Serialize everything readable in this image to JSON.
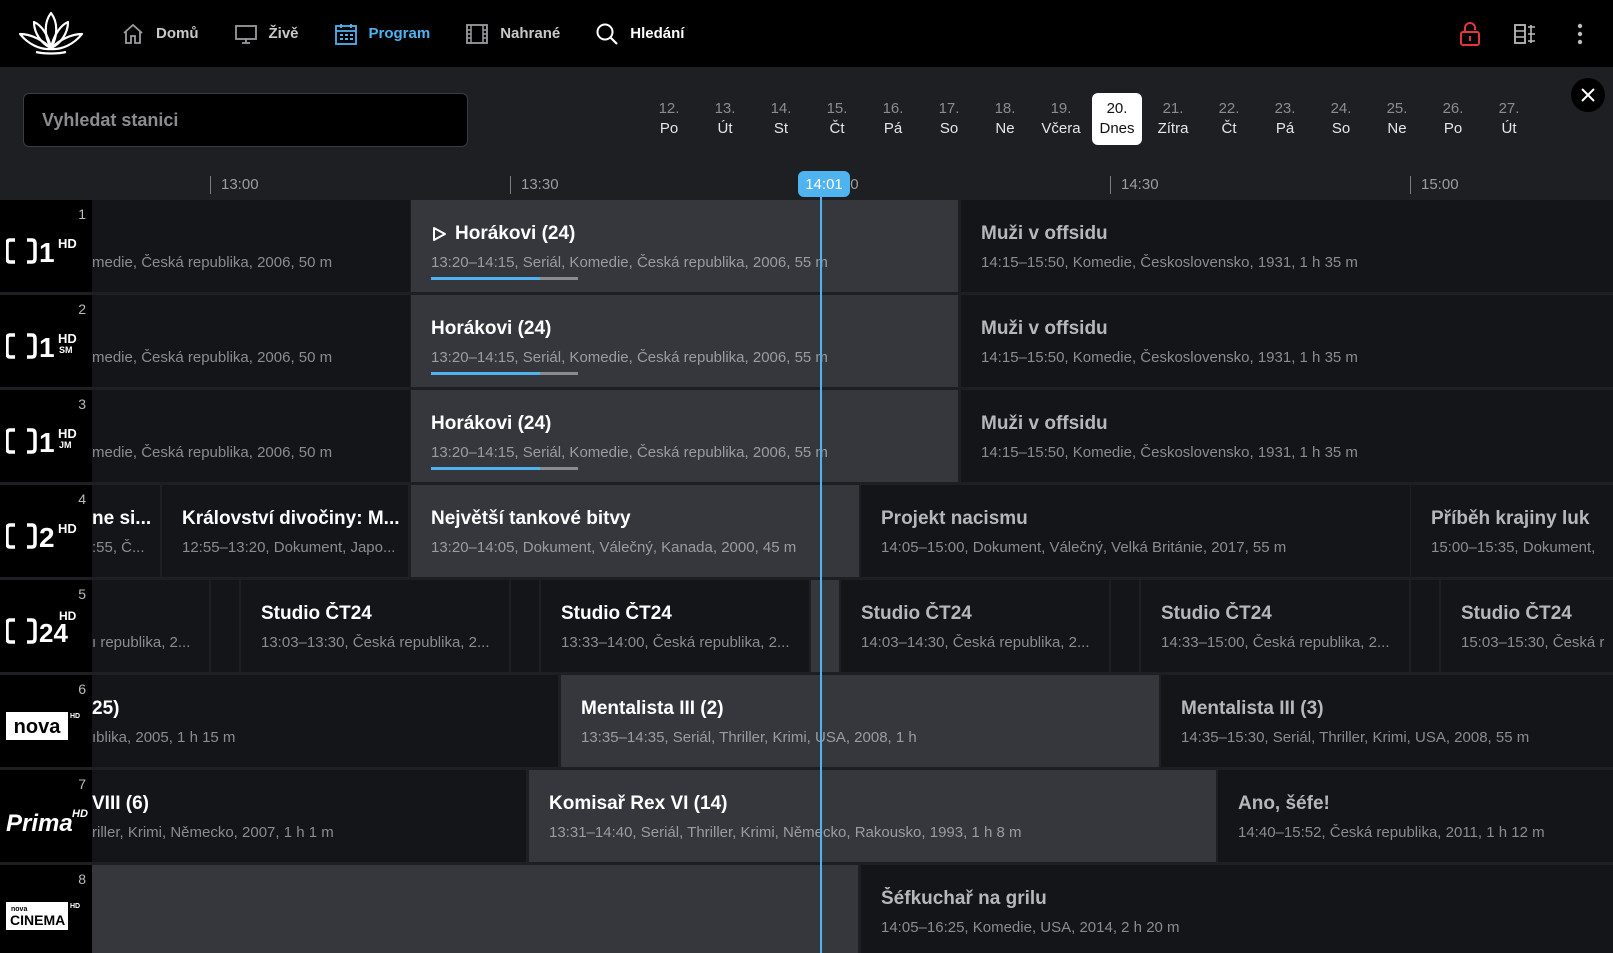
{
  "nav": {
    "items": [
      {
        "label": "Domů",
        "icon": "home-icon",
        "state": "normal"
      },
      {
        "label": "Živě",
        "icon": "tv-icon",
        "state": "normal"
      },
      {
        "label": "Program",
        "icon": "calendar-icon",
        "state": "active"
      },
      {
        "label": "Nahrané",
        "icon": "film-icon",
        "state": "normal"
      },
      {
        "label": "Hledání",
        "icon": "search-icon",
        "state": "white"
      }
    ]
  },
  "top_right": {
    "icons": [
      "lock-icon",
      "layout-icon",
      "more-vertical-icon"
    ]
  },
  "search": {
    "placeholder": "Vyhledat stanici"
  },
  "dates": [
    {
      "num": "12.",
      "label": "Po"
    },
    {
      "num": "13.",
      "label": "Út"
    },
    {
      "num": "14.",
      "label": "St"
    },
    {
      "num": "15.",
      "label": "Čt"
    },
    {
      "num": "16.",
      "label": "Pá"
    },
    {
      "num": "17.",
      "label": "So"
    },
    {
      "num": "18.",
      "label": "Ne"
    },
    {
      "num": "19.",
      "label": "Včera"
    },
    {
      "num": "20.",
      "label": "Dnes",
      "selected": true
    },
    {
      "num": "21.",
      "label": "Zítra"
    },
    {
      "num": "22.",
      "label": "Čt"
    },
    {
      "num": "23.",
      "label": "Pá"
    },
    {
      "num": "24.",
      "label": "So"
    },
    {
      "num": "25.",
      "label": "Ne"
    },
    {
      "num": "26.",
      "label": "Po"
    },
    {
      "num": "27.",
      "label": "Út"
    }
  ],
  "timeline": {
    "ticks": [
      "13:00",
      "13:30",
      "14:00",
      "14:30",
      "15:00"
    ],
    "now": "14:01"
  },
  "channels": [
    {
      "num": "1",
      "logo": "ct1-hd",
      "programs": [
        {
          "title": "",
          "desc": "medie, Česká republika, 2006, 50 m",
          "state": "past"
        },
        {
          "title": "Horákovi (24)",
          "desc": "13:20–14:15, Seriál, Komedie, Česká republika, 2006, 55 m",
          "state": "current",
          "playing": true,
          "progress": 0.74
        },
        {
          "title": "Muži v offsidu",
          "desc": "14:15–15:50, Komedie, Československo, 1931, 1 h 35 m",
          "state": "future"
        }
      ]
    },
    {
      "num": "2",
      "logo": "ct1-hd-sm",
      "programs": [
        {
          "title": "",
          "desc": "medie, Česká republika, 2006, 50 m",
          "state": "past"
        },
        {
          "title": "Horákovi (24)",
          "desc": "13:20–14:15, Seriál, Komedie, Česká republika, 2006, 55 m",
          "state": "current",
          "progress": 0.74
        },
        {
          "title": "Muži v offsidu",
          "desc": "14:15–15:50, Komedie, Československo, 1931, 1 h 35 m",
          "state": "future"
        }
      ]
    },
    {
      "num": "3",
      "logo": "ct1-hd-jm",
      "programs": [
        {
          "title": "",
          "desc": "medie, Česká republika, 2006, 50 m",
          "state": "past"
        },
        {
          "title": "Horákovi (24)",
          "desc": "13:20–14:15, Seriál, Komedie, Česká republika, 2006, 55 m",
          "state": "current",
          "progress": 0.74
        },
        {
          "title": "Muži v offsidu",
          "desc": "14:15–15:50, Komedie, Československo, 1931, 1 h 35 m",
          "state": "future"
        }
      ]
    },
    {
      "num": "4",
      "logo": "ct2-hd",
      "programs": [
        {
          "title": "ne si...",
          "desc": ":55, Č...",
          "state": "past"
        },
        {
          "title": "Království divočiny: M...",
          "desc": "12:55–13:20, Dokument, Japo...",
          "state": "past"
        },
        {
          "title": "Největší tankové bitvy",
          "desc": "13:20–14:05, Dokument, Válečný, Kanada, 2000, 45 m",
          "state": "current"
        },
        {
          "title": "Projekt nacismu",
          "desc": "14:05–15:00, Dokument, Válečný, Velká Británie, 2017, 55 m",
          "state": "future"
        },
        {
          "title": "Příběh krajiny luk",
          "desc": "15:00–15:35, Dokument,",
          "state": "future"
        }
      ]
    },
    {
      "num": "5",
      "logo": "ct24-hd",
      "programs": [
        {
          "title": "",
          "desc": "ı republika, 2...",
          "state": "past"
        },
        {
          "title": "",
          "desc": "",
          "state": "past"
        },
        {
          "title": "Studio ČT24",
          "desc": "13:03–13:30, Česká republika, 2...",
          "state": "past"
        },
        {
          "title": "",
          "desc": "",
          "state": "past"
        },
        {
          "title": "Studio ČT24",
          "desc": "13:33–14:00, Česká republika, 2...",
          "state": "past"
        },
        {
          "title": "",
          "desc": "",
          "state": "current"
        },
        {
          "title": "Studio ČT24",
          "desc": "14:03–14:30, Česká republika, 2...",
          "state": "future"
        },
        {
          "title": "",
          "desc": "",
          "state": "future"
        },
        {
          "title": "Studio ČT24",
          "desc": "14:33–15:00, Česká republika, 2...",
          "state": "future"
        },
        {
          "title": "",
          "desc": "",
          "state": "future"
        },
        {
          "title": "Studio ČT24",
          "desc": "15:03–15:30, Česká r",
          "state": "future"
        }
      ]
    },
    {
      "num": "6",
      "logo": "nova-hd",
      "programs": [
        {
          "title": "25)",
          "desc": "ıblika, 2005, 1 h 15 m",
          "state": "past"
        },
        {
          "title": "Mentalista III (2)",
          "desc": "13:35–14:35, Seriál, Thriller, Krimi, USA, 2008, 1 h",
          "state": "current"
        },
        {
          "title": "Mentalista III (3)",
          "desc": "14:35–15:30, Seriál, Thriller, Krimi, USA, 2008, 55 m",
          "state": "future"
        }
      ]
    },
    {
      "num": "7",
      "logo": "prima-hd",
      "programs": [
        {
          "title": "VIII (6)",
          "desc": "riller, Krimi, Německo, 2007, 1 h 1 m",
          "state": "past"
        },
        {
          "title": "Komisař Rex VI (14)",
          "desc": "13:31–14:40, Seriál, Thriller, Krimi, Německo, Rakousko, 1993, 1 h 8 m",
          "state": "current"
        },
        {
          "title": "Ano, šéfe!",
          "desc": "14:40–15:52, Česká republika, 2011, 1 h 12 m",
          "state": "future"
        }
      ]
    },
    {
      "num": "8",
      "logo": "nova-cinema-hd",
      "programs": [
        {
          "title": "",
          "desc": "",
          "state": "current"
        },
        {
          "title": "Šéfkuchař na grilu",
          "desc": "14:05–16:25, Komedie, USA, 2014, 2 h 20 m",
          "state": "future"
        }
      ]
    }
  ],
  "logo_text": {
    "ct_hd": "HD",
    "ct_sm": "SM",
    "ct_jm": "JM",
    "nova": "nova",
    "prima": "Prima",
    "nova_small": "nova",
    "cinema": "CINEMA"
  },
  "colors": {
    "accent": "#4fb3f0",
    "lock": "#e8343c"
  }
}
